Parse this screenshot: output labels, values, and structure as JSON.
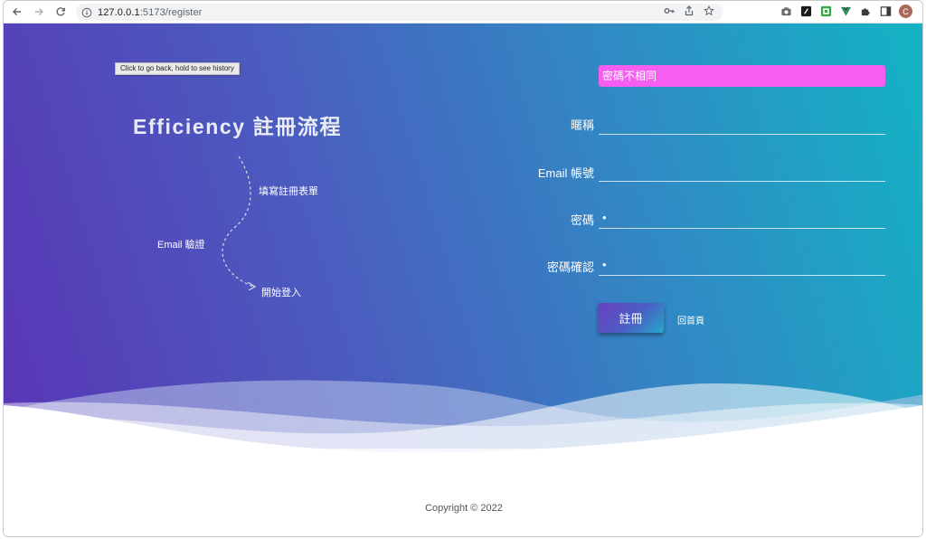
{
  "browser": {
    "url_host": "127.0.0.1",
    "url_path": ":5173/register",
    "avatar_letter": "C",
    "back_tooltip": "Click to go back, hold to see history"
  },
  "page": {
    "title": "Efficiency 註冊流程",
    "steps": [
      {
        "label": "填寫註冊表單"
      },
      {
        "label": "Email 驗證"
      },
      {
        "label": "開始登入"
      }
    ],
    "error_message": "密碼不相同",
    "form": {
      "nickname_label": "暱稱",
      "nickname_value": "",
      "email_label": "Email 帳號",
      "email_value": "",
      "password_label": "密碼",
      "password_value": "1",
      "confirm_label": "密碼確認",
      "confirm_value": "2"
    },
    "submit_label": "註冊",
    "home_link": "回首頁",
    "copyright": "Copyright © 2022"
  },
  "colors": {
    "gradient_start": "#5a35b6",
    "gradient_end": "#12b4c4",
    "error_bg": "#f55ef0"
  }
}
